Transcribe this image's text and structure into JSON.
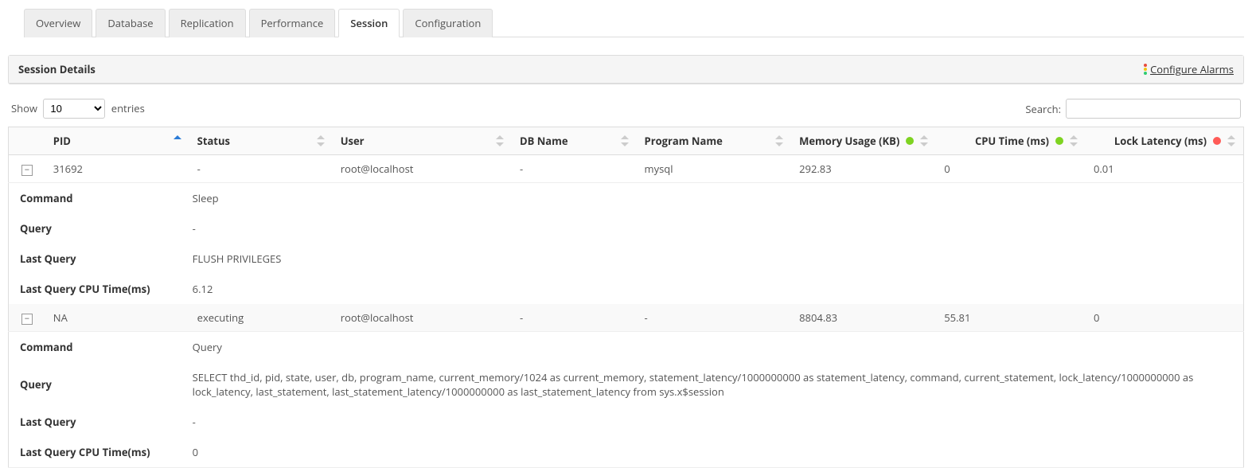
{
  "tabs": [
    {
      "label": "Overview"
    },
    {
      "label": "Database"
    },
    {
      "label": "Replication"
    },
    {
      "label": "Performance"
    },
    {
      "label": "Session",
      "active": true
    },
    {
      "label": "Configuration"
    }
  ],
  "panel": {
    "title": "Session Details",
    "configure_link": "Configure Alarms"
  },
  "length_control": {
    "prefix": "Show",
    "suffix": "entries",
    "value": "10"
  },
  "search": {
    "label": "Search:",
    "value": ""
  },
  "columns": {
    "pid": "PID",
    "status": "Status",
    "user": "User",
    "db": "DB Name",
    "program": "Program Name",
    "memory": "Memory Usage (KB)",
    "cpu": "CPU Time (ms)",
    "lock": "Lock Latency (ms)"
  },
  "header_status": {
    "memory": "green",
    "cpu": "green",
    "lock": "red"
  },
  "detail_labels": {
    "command": "Command",
    "query": "Query",
    "last_query": "Last Query",
    "last_query_cpu": "Last Query CPU Time(ms)"
  },
  "rows": [
    {
      "pid": "31692",
      "status": "-",
      "user": "root@localhost",
      "db": "-",
      "program": "mysql",
      "memory": "292.83",
      "cpu": "0",
      "lock": "0.01",
      "detail": {
        "command": "Sleep",
        "query": "-",
        "last_query": "FLUSH PRIVILEGES",
        "last_query_cpu": "6.12"
      }
    },
    {
      "pid": "NA",
      "status": "executing",
      "user": "root@localhost",
      "db": "-",
      "program": "-",
      "memory": "8804.83",
      "cpu": "55.81",
      "lock": "0",
      "detail": {
        "command": "Query",
        "query": "SELECT thd_id, pid, state, user, db, program_name, current_memory/1024 as current_memory, statement_latency/1000000000 as statement_latency, command, current_statement, lock_latency/1000000000 as lock_latency, last_statement, last_statement_latency/1000000000 as last_statement_latency from sys.x$session",
        "last_query": "-",
        "last_query_cpu": "0"
      }
    }
  ]
}
